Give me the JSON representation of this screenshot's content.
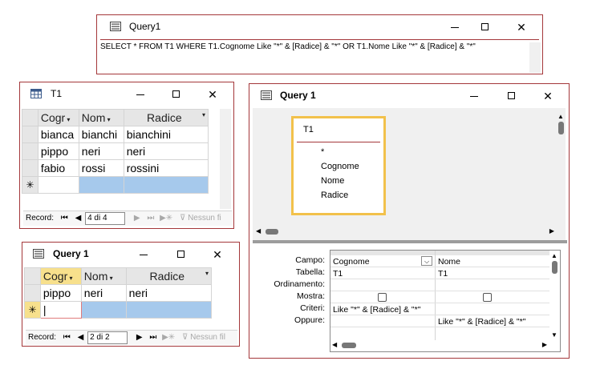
{
  "sql_window": {
    "title": "Query1",
    "sql_text": "SELECT * FROM T1 WHERE T1.Cognome Like \"*\" & [Radice] & \"*\" OR T1.Nome Like \"*\" & [Radice] & \"*\""
  },
  "t1_window": {
    "title": "T1",
    "columns": [
      "Cogr",
      "Nom",
      "Radice"
    ],
    "rows": [
      [
        "bianca",
        "bianchi",
        "bianchini"
      ],
      [
        "pippo",
        "neri",
        "neri"
      ],
      [
        "fabio",
        "rossi",
        "rossini"
      ]
    ],
    "new_row_marker": "✳",
    "nav": {
      "label": "Record:",
      "position": "4 di 4",
      "filter": "Nessun fi"
    }
  },
  "q1_small_window": {
    "title": "Query 1",
    "columns": [
      "Cogr",
      "Nom",
      "Radice"
    ],
    "rows": [
      [
        "pippo",
        "neri",
        "neri"
      ]
    ],
    "new_row_marker": "✳",
    "nav": {
      "label": "Record:",
      "position": "2 di 2",
      "filter": "Nessun fil"
    }
  },
  "design_window": {
    "title": "Query 1",
    "table_box": {
      "name": "T1",
      "fields": [
        "*",
        "Cognome",
        "Nome",
        "Radice"
      ]
    },
    "row_labels": [
      "Campo:",
      "Tabella:",
      "Ordinamento:",
      "Mostra:",
      "Criteri:",
      "Oppure:"
    ],
    "columns": [
      {
        "campo": "Cognome",
        "tabella": "T1",
        "criteri": "Like \"*\" & [Radice] & \"*\"",
        "oppure": ""
      },
      {
        "campo": "Nome",
        "tabella": "T1",
        "criteri": "",
        "oppure": "Like \"*\" & [Radice] & \"*\""
      }
    ]
  },
  "icons": {
    "query": "query-icon",
    "table": "table-icon",
    "minimize": "minimize-icon",
    "maximize": "maximize-icon",
    "close": "close-icon"
  },
  "colors": {
    "window_border": "#a4373a",
    "selection": "#a6c9ec",
    "table_highlight": "#f2c14b",
    "current_cell_header": "#f7e08c"
  }
}
